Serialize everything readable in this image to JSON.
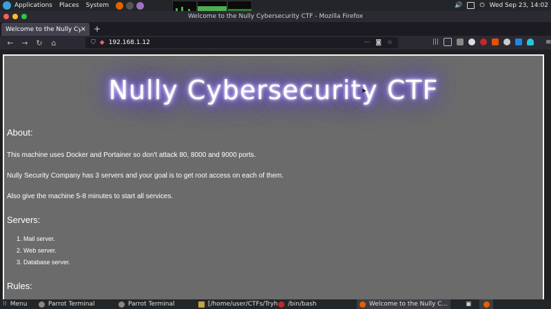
{
  "top_panel": {
    "menu": [
      "Applications",
      "Places",
      "System"
    ],
    "clock": "Wed Sep 23, 14:02"
  },
  "window": {
    "title": "Welcome to the Nully Cybersecurity CTF - Mozilla Firefox",
    "tab_label": "Welcome to the Nully Cyber",
    "url": "192.168.1.12"
  },
  "page": {
    "hero": "Nully Cybersecurity CTF",
    "about_heading": "About:",
    "about_lines": [
      "This machine uses Docker and Portainer so don't attack 80, 8000 and 9000 ports.",
      "Nully Security Company has 3 servers and your goal is to get root access on each of them.",
      "Also give the machine 5-8 minutes to start all services."
    ],
    "servers_heading": "Servers:",
    "servers": [
      "Mail server.",
      "Web server.",
      "Database server."
    ],
    "rules_heading": "Rules:"
  },
  "taskbar": {
    "menu": "Menu",
    "tasks": [
      "Parrot Terminal",
      "Parrot Terminal",
      "[/home/user/CTFs/Tryh...",
      "/bin/bash",
      "Welcome to the Nully C..."
    ]
  },
  "colors": {
    "page_bg": "#6b6b6b",
    "glow": "#5a34ff",
    "chrome_bg": "#2b2a33"
  }
}
